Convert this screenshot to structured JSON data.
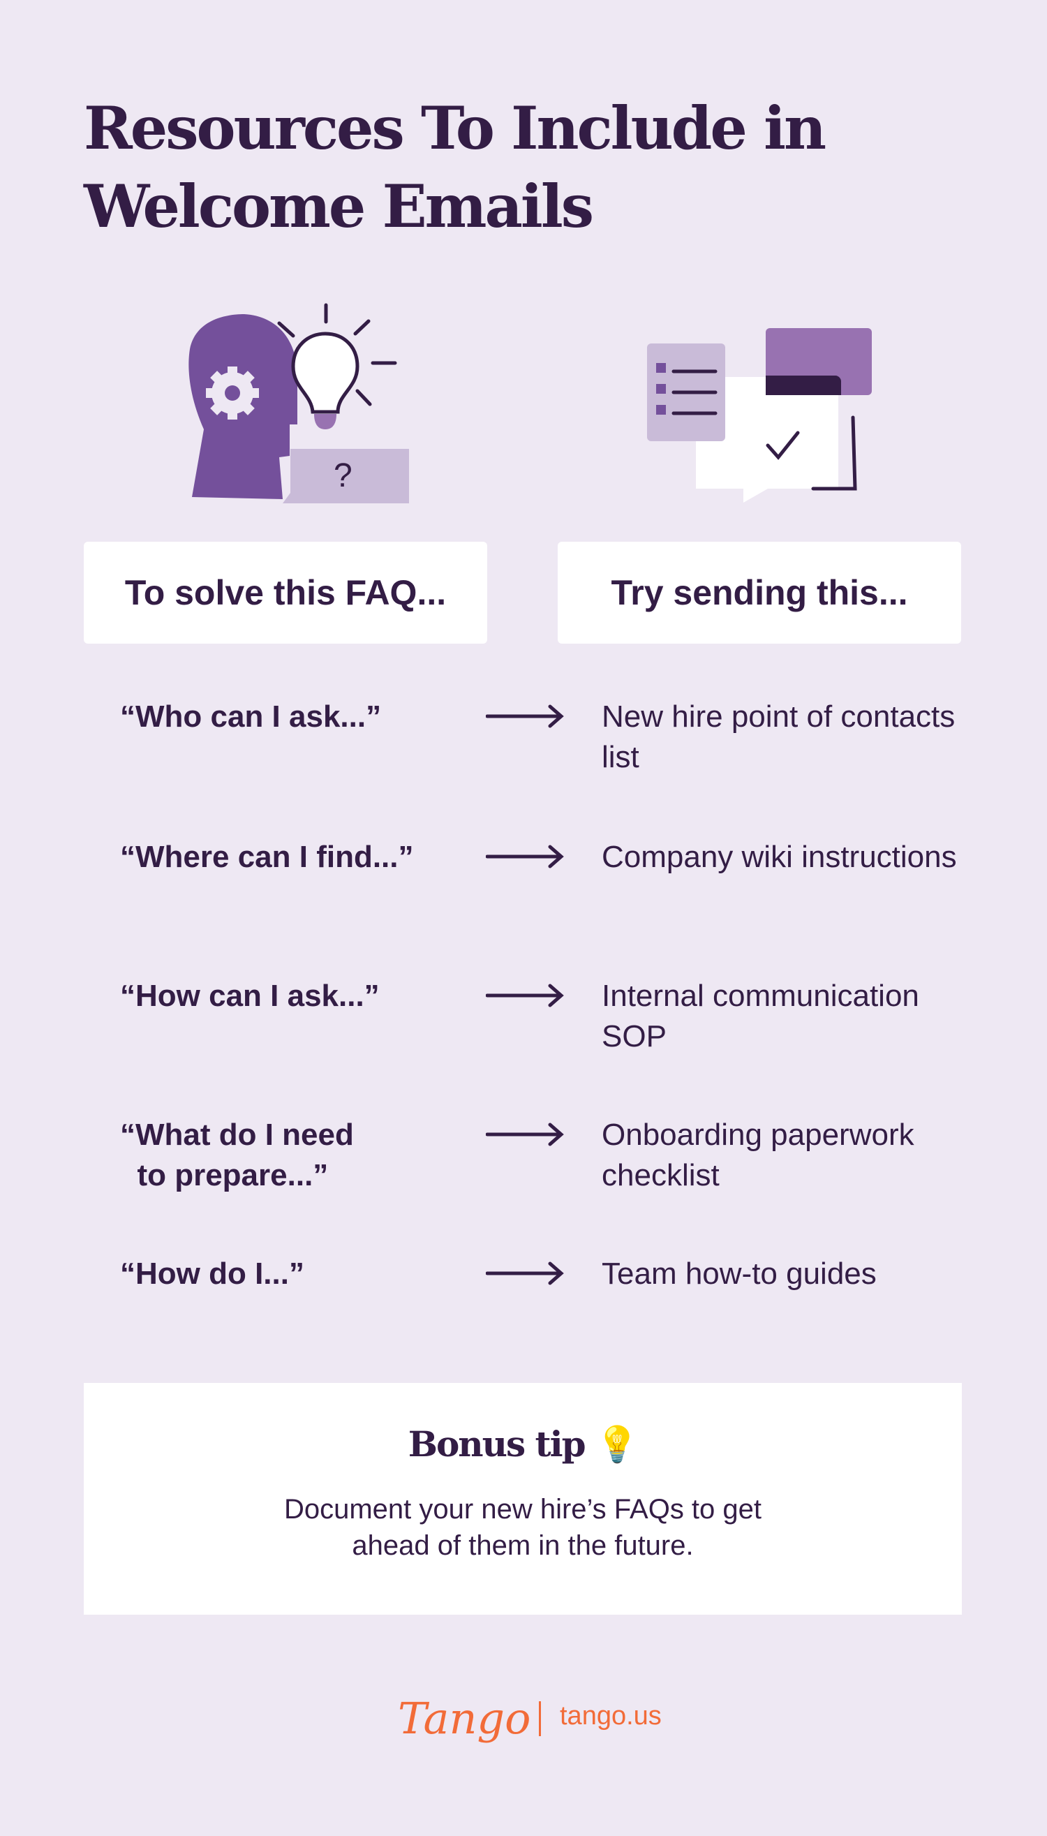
{
  "title": "Resources To Include in Welcome Emails",
  "illustrations": {
    "left": "head-gear-lightbulb-question-illustration",
    "right": "checklist-chat-illustration"
  },
  "headers": {
    "left": "To solve this FAQ...",
    "right": "Try sending this..."
  },
  "rows": [
    {
      "faq": "“Who can I ask...”",
      "resource": "New hire point of contacts list"
    },
    {
      "faq": "“Where can I find...”",
      "resource": "Company wiki instructions"
    },
    {
      "faq": "“How can I ask...”",
      "resource": "Internal communication SOP"
    },
    {
      "faq": "“What do I need\n  to prepare...”",
      "resource": "Onboarding paperwork checklist"
    },
    {
      "faq": "“How do I...”",
      "resource": "Team how-to guides"
    }
  ],
  "bonus": {
    "title": "Bonus tip",
    "emoji": "💡",
    "body": "Document your new hire’s FAQs to get ahead of them in the future."
  },
  "footer": {
    "logo": "Tango",
    "url": "tango.us"
  },
  "colors": {
    "background": "#eee8f3",
    "text": "#331d45",
    "purple": "#74509b",
    "light_purple": "#c9bbd8",
    "accent_orange": "#f26b38"
  }
}
